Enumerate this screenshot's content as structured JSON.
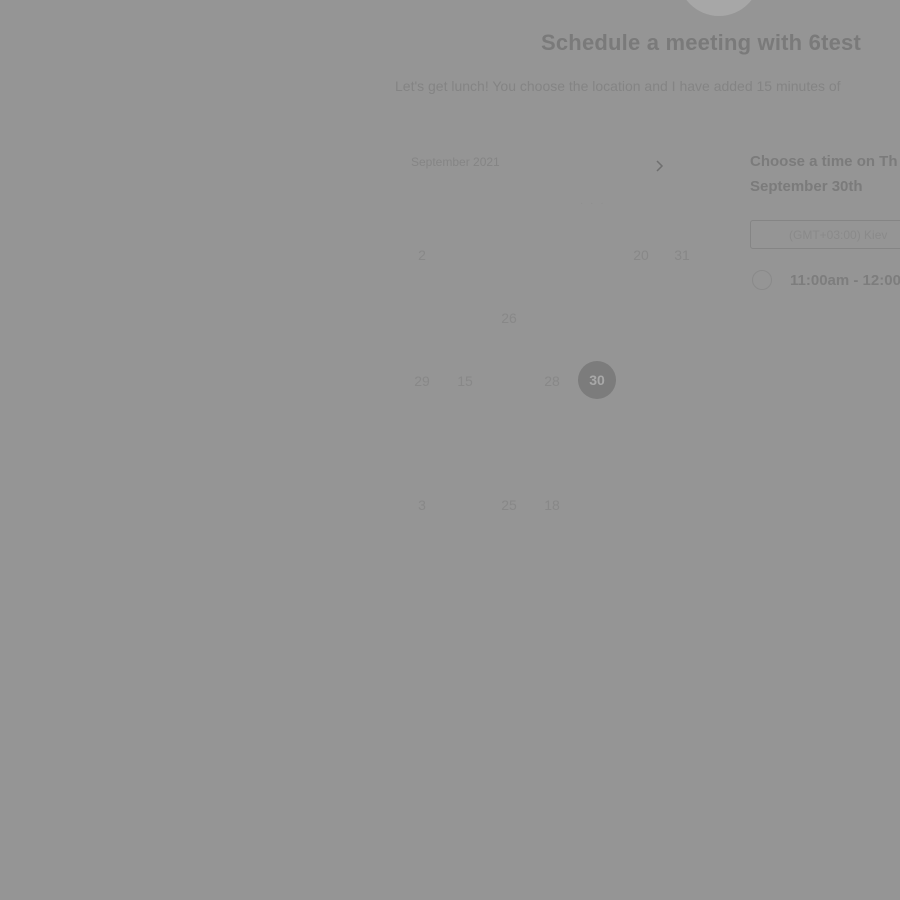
{
  "header": {
    "title": "Schedule a meeting with 6test",
    "subtitle": "Let's get lunch! You choose the location and I have added 15 minutes of"
  },
  "calendar": {
    "month_label": "September 2021",
    "next_icon": "chevron-right-icon",
    "weekdays_faint": "· · ·",
    "days": [
      {
        "label": "2"
      },
      {
        "label": "20"
      },
      {
        "label": "31"
      },
      {
        "label": "26"
      },
      {
        "label": "29"
      },
      {
        "label": "15"
      },
      {
        "label": "28"
      },
      {
        "label": "30",
        "selected": true
      },
      {
        "label": "3"
      },
      {
        "label": "25"
      },
      {
        "label": "18"
      }
    ]
  },
  "side": {
    "heading_line1": "Choose a time on Th",
    "heading_line2": "September 30th",
    "timezone": "(GMT+03:00) Kiev",
    "slots": [
      {
        "label": "11:00am - 12:00"
      }
    ]
  }
}
